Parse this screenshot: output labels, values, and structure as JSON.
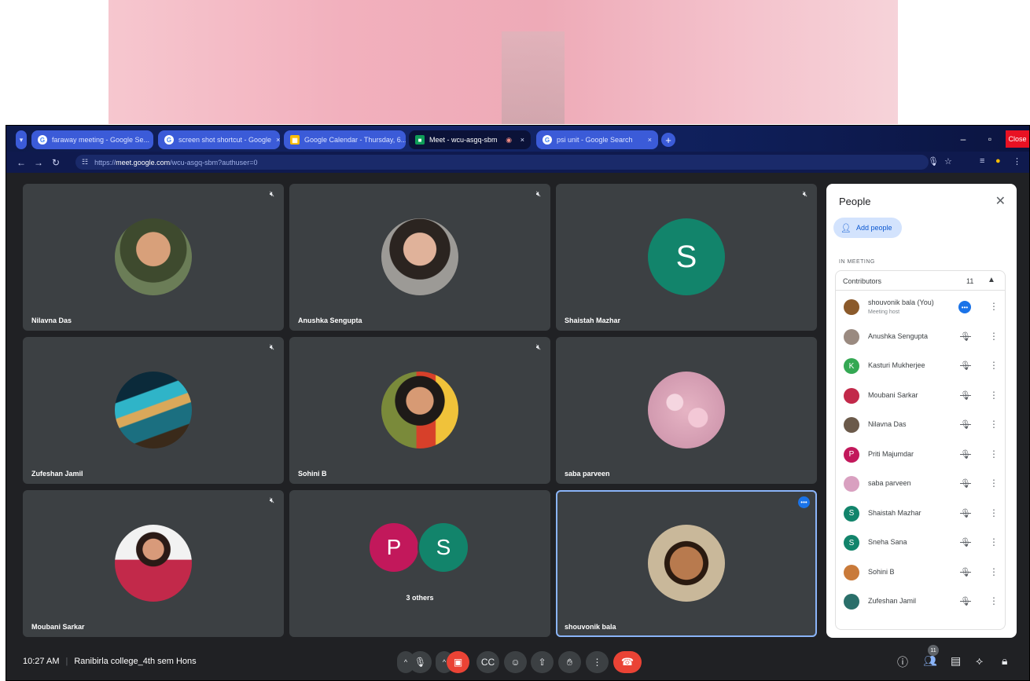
{
  "browser": {
    "tabs": [
      {
        "label": "faraway meeting - Google Se..."
      },
      {
        "label": "screen shot shortcut - Google"
      },
      {
        "label": "Google Calendar - Thursday, 6..."
      },
      {
        "label": "Meet - wcu-asgq-sbm"
      },
      {
        "label": "psi unit - Google Search"
      }
    ],
    "close_label": "Close",
    "url_prefix": "https://",
    "url_site": "meet.google.com",
    "url_rest": "/wcu-asgq-sbm?authuser=0"
  },
  "tiles": [
    {
      "name": "Nilavna Das",
      "muted": true,
      "avatar_color": "#6b7d57"
    },
    {
      "name": "Anushka Sengupta",
      "muted": true,
      "avatar_color": "#8a8a8a"
    },
    {
      "name": "Shaistah Mazhar",
      "muted": true,
      "letter": "S",
      "avatar_color": "#12846b"
    },
    {
      "name": "Zufeshan Jamil",
      "muted": true,
      "avatar_color": "#1b6f80"
    },
    {
      "name": "Sohini B",
      "muted": true,
      "avatar_color": "#c9a53a"
    },
    {
      "name": "saba parveen",
      "muted": false,
      "avatar_color": "#e6b4c4"
    },
    {
      "name": "Moubani Sarkar",
      "muted": true,
      "avatar_color": "#c2294a"
    },
    {
      "name": "3 others",
      "letters": [
        "P",
        "S"
      ],
      "colors": [
        "#c2185b",
        "#12846b"
      ]
    },
    {
      "name": "shouvonik bala",
      "speaking": true,
      "avatar_color": "#a2612e"
    }
  ],
  "panel": {
    "title": "People",
    "add_people": "Add people",
    "in_meeting": "IN MEETING",
    "contributors_label": "Contributors",
    "contributors_count": "11",
    "people": [
      {
        "name": "shouvonik bala (You)",
        "sub": "Meeting host",
        "color": "#8b5a2b",
        "host": true
      },
      {
        "name": "Anushka Sengupta",
        "color": "#9a8a80"
      },
      {
        "name": "Kasturi Mukherjee",
        "letter": "K",
        "color": "#34a853"
      },
      {
        "name": "Moubani Sarkar",
        "color": "#c2294a"
      },
      {
        "name": "Nilavna Das",
        "color": "#6b5a4a"
      },
      {
        "name": "Priti Majumdar",
        "letter": "P",
        "color": "#c2185b"
      },
      {
        "name": "saba parveen",
        "color": "#d9a0c0"
      },
      {
        "name": "Shaistah Mazhar",
        "letter": "S",
        "color": "#12846b"
      },
      {
        "name": "Sneha Sana",
        "letter": "S",
        "color": "#12846b"
      },
      {
        "name": "Sohini B",
        "color": "#c97a3a"
      },
      {
        "name": "Zufeshan Jamil",
        "color": "#2a6f6a"
      }
    ]
  },
  "bottom": {
    "time": "10:27 AM",
    "meeting_name": "Ranibirla college_4th sem Hons",
    "participants_badge": "11"
  }
}
